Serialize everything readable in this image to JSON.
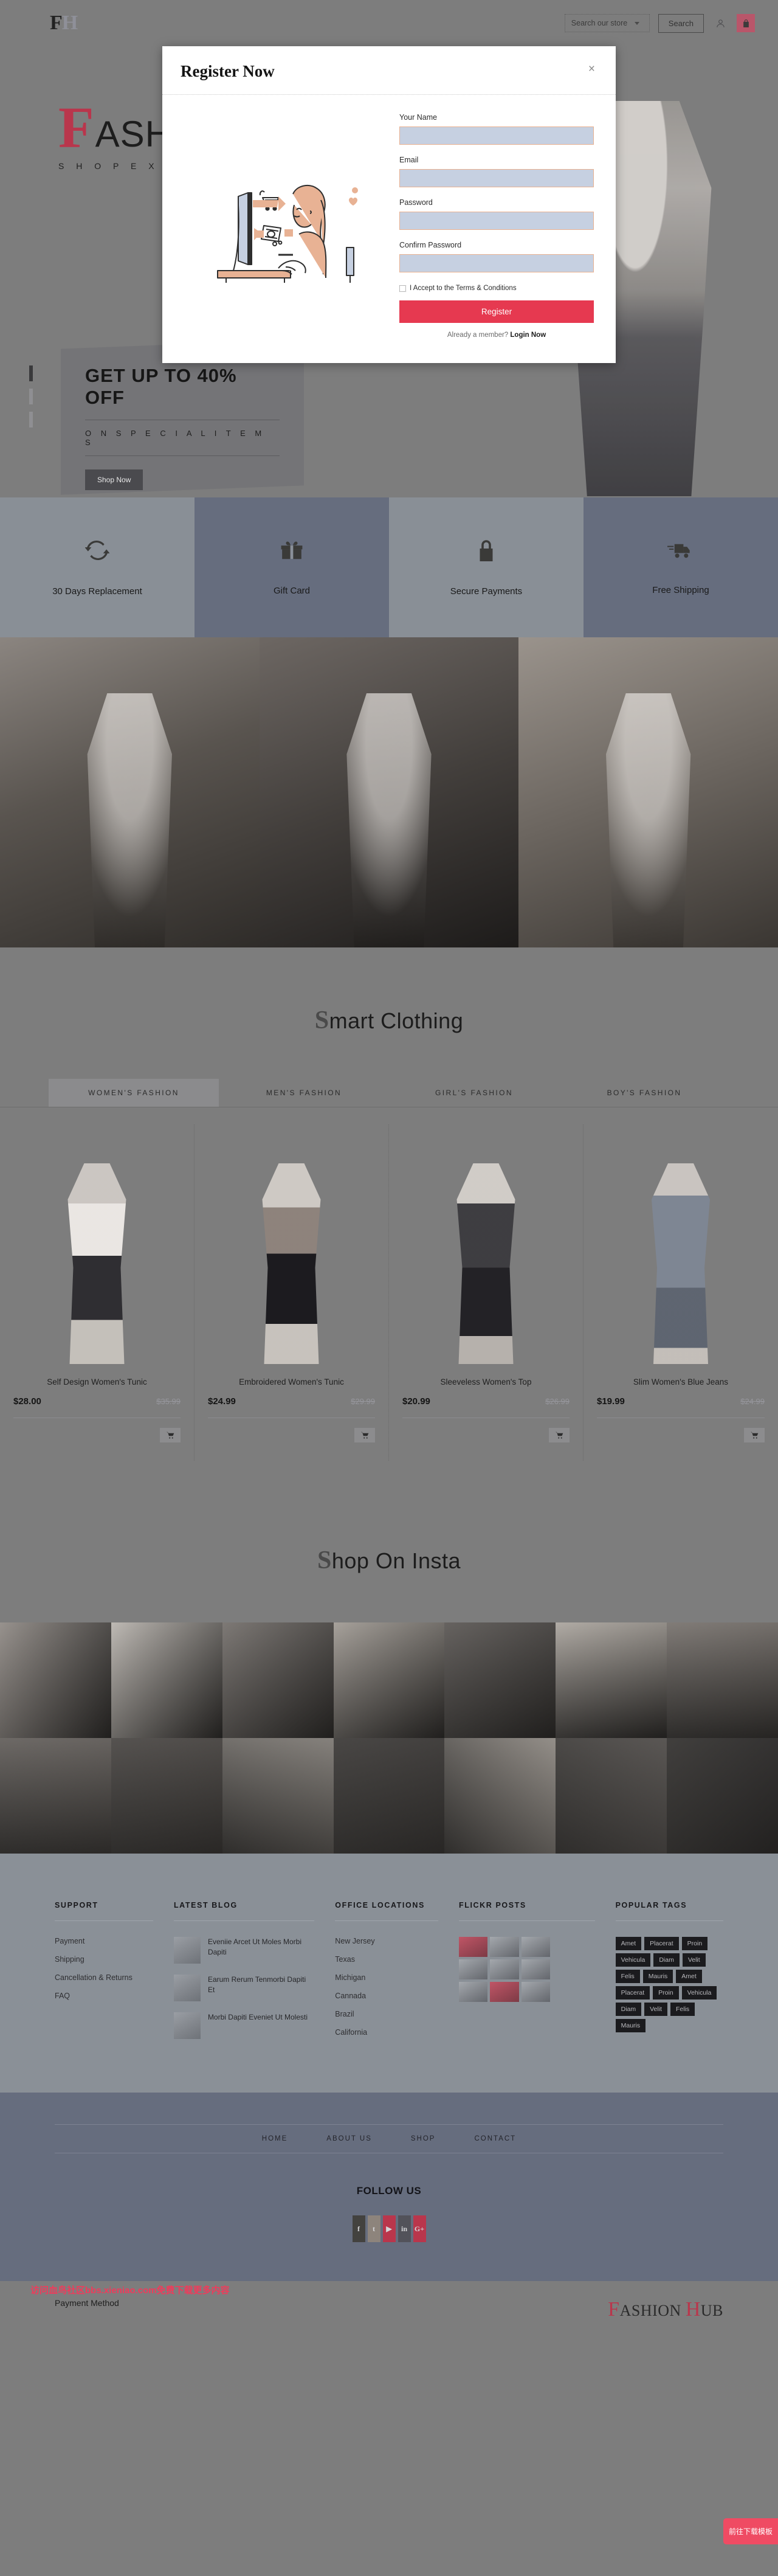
{
  "header": {
    "logo_main": "F",
    "logo_rest": "H",
    "search_select_value": "Search our store",
    "search_button": "Search",
    "account_icon": "user-icon",
    "cart_icon": "shopping-bag-icon"
  },
  "hero": {
    "brand_cap": "F",
    "brand_word": "ASHION",
    "brand_tagline": "S H O P   E X C L U S I V E",
    "headline": "GET UP TO 40% OFF",
    "subline": "O N   S P E C I A L   I T E M S",
    "cta": "Shop Now",
    "slides": 3,
    "active_slide": 1
  },
  "features": [
    {
      "icon": "refresh-icon",
      "label": "30 Days Replacement"
    },
    {
      "icon": "gift-icon",
      "label": "Gift Card"
    },
    {
      "icon": "lock-icon",
      "label": "Secure Payments"
    },
    {
      "icon": "truck-icon",
      "label": "Free Shipping"
    }
  ],
  "smart_clothing": {
    "title_cap": "S",
    "title_rest": "mart Clothing",
    "tabs": [
      {
        "label": "WOMEN'S  FASHION",
        "active": true
      },
      {
        "label": "MEN'S  FASHION",
        "active": false
      },
      {
        "label": "GIRL'S  FASHION",
        "active": false
      },
      {
        "label": "BOY'S  FASHION",
        "active": false
      }
    ],
    "products": [
      {
        "name": "Self Design Women's Tunic",
        "price": "$28.00",
        "old_price": "$35.99",
        "cart_icon": "cart-icon"
      },
      {
        "name": "Embroidered Women's Tunic",
        "price": "$24.99",
        "old_price": "$29.99",
        "cart_icon": "cart-icon"
      },
      {
        "name": "Sleeveless Women's Top",
        "price": "$20.99",
        "old_price": "$26.99",
        "cart_icon": "cart-icon"
      },
      {
        "name": "Slim Women's Blue Jeans",
        "price": "$19.99",
        "old_price": "$24.99",
        "cart_icon": "cart-icon"
      }
    ]
  },
  "insta": {
    "title_cap": "S",
    "title_rest": "hop On Insta",
    "cells": 14
  },
  "footer": {
    "support": {
      "heading": "SUPPORT",
      "links": [
        "Payment",
        "Shipping",
        "Cancellation & Returns",
        "FAQ"
      ]
    },
    "blog": {
      "heading": "LATEST BLOG",
      "posts": [
        "Eveniie Arcet Ut Moles Morbi Dapiti",
        "Earum Rerum Tenmorbi Dapiti Et",
        "Morbi Dapiti Eveniet Ut Molesti"
      ]
    },
    "offices": {
      "heading": "OFFICE LOCATIONS",
      "links": [
        "New Jersey",
        "Texas",
        "Michigan",
        "Cannada",
        "Brazil",
        "California"
      ]
    },
    "flickr": {
      "heading": "FLICKR POSTS",
      "cells": 9
    },
    "tags": {
      "heading": "POPULAR TAGS",
      "items": [
        "Amet",
        "Placerat",
        "Proin",
        "Vehicula",
        "Diam",
        "Velit",
        "Felis",
        "Mauris",
        "Amet",
        "Placerat",
        "Proin",
        "Vehicula",
        "Diam",
        "Velit",
        "Felis",
        "Mauris"
      ]
    },
    "nav": [
      "HOME",
      "ABOUT US",
      "SHOP",
      "CONTACT"
    ],
    "follow_title": "FOLLOW US",
    "socials": [
      {
        "icon": "facebook-icon",
        "glyph": "f"
      },
      {
        "icon": "twitter-icon",
        "glyph": "t"
      },
      {
        "icon": "youtube-icon",
        "glyph": "▶"
      },
      {
        "icon": "linkedin-icon",
        "glyph": "in"
      },
      {
        "icon": "googleplus-icon",
        "glyph": "G+"
      }
    ],
    "payment_method": "Payment Method",
    "brand_cap": "F",
    "brand_rest": "ASHION  ",
    "brand_cap2": "H",
    "brand_rest2": "UB"
  },
  "modal": {
    "title": "Register Now",
    "close": "×",
    "illustration": "woman-at-computer-shopping-illustration",
    "fields": [
      {
        "label": "Your Name",
        "value": "",
        "placeholder": ""
      },
      {
        "label": "Email",
        "value": "",
        "placeholder": ""
      },
      {
        "label": "Password",
        "value": "",
        "placeholder": ""
      },
      {
        "label": "Confirm Password",
        "value": "",
        "placeholder": ""
      }
    ],
    "terms_label": "I Accept to the Terms & Conditions",
    "terms_checked": false,
    "submit": "Register",
    "already_text": "Already a member? ",
    "login_link": "Login Now"
  },
  "overlay_extras": {
    "watermark": "访问血鸟社区bbs.xieniao.com免费下载更多内容",
    "float_cta": "前往下载模板"
  },
  "colors": {
    "accent_red": "#e63950",
    "brand_red": "#b9364c",
    "field_fill": "#c6d0e1",
    "field_border": "#e9b191",
    "page_bg": "#7d7d7d"
  }
}
